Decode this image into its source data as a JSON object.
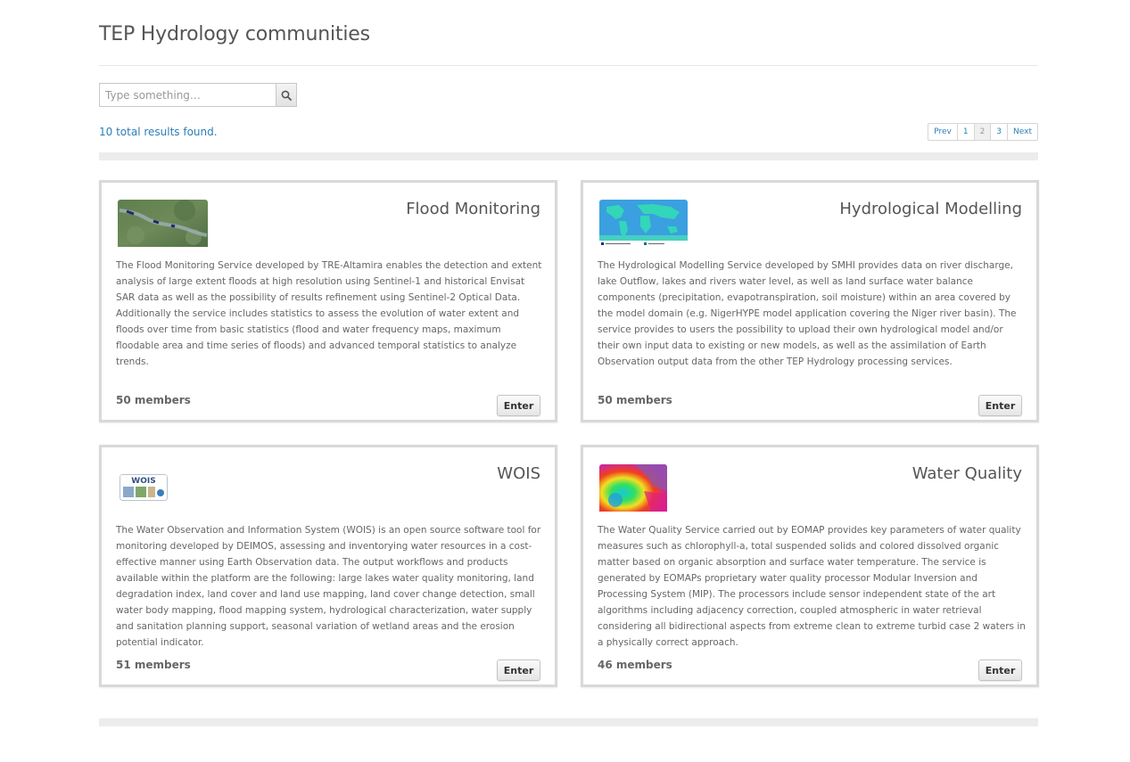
{
  "page_title": "TEP Hydrology communities",
  "search": {
    "placeholder": "Type something…",
    "icon": "search-icon"
  },
  "results_text": "10 total results found.",
  "pagination": {
    "prev": "Prev",
    "pages": [
      "1",
      "2",
      "3"
    ],
    "current": "2",
    "next": "Next"
  },
  "cards": [
    {
      "title": "Flood Monitoring",
      "description": "The Flood Monitoring Service developed by TRE-Altamira enables the detection and extent analysis of large extent floods at high resolution using Sentinel-1 and historical Envisat SAR data as well as the possibility of results refinement using Sentinel-2 Optical Data. Additionally the service includes statistics to assess the evolution of water extent and floods over time from basic statistics (flood and water frequency maps, maximum floodable area and time series of floods) and advanced temporal statistics to analyze trends.",
      "members": "50 members",
      "enter": "Enter",
      "thumb": "satellite-flood-image"
    },
    {
      "title": "Hydrological Modelling",
      "description": "The Hydrological Modelling Service developed by SMHI provides data on river discharge, lake Outflow, lakes and rivers water level, as well as land surface water balance components (precipitation, evapotranspiration, soil moisture) within an area covered by the model domain (e.g. NigerHYPE model application covering the Niger river basin). The service provides to users the possibility to upload their own hydrological model and/or their own input data to existing or new models, as well as the assimilation of Earth Observation output data from the other TEP Hydrology processing services.",
      "members": "50 members",
      "enter": "Enter",
      "thumb": "world-map-image"
    },
    {
      "title": "WOIS",
      "description": "The Water Observation and Information System (WOIS) is an open source software tool for monitoring developed by DEIMOS, assessing and inventorying water resources in a cost-effective manner using Earth Observation data. The output workflows and products available within the platform are the following: large lakes water quality monitoring, land degradation index, land cover and land use mapping, land cover change detection, small water body mapping, flood mapping system, hydrological characterization, water supply and sanitation planning support, seasonal variation of wetland areas and the erosion potential indicator.",
      "members": "51 members",
      "enter": "Enter",
      "thumb": "wois-logo",
      "thumb_text": "WOIS"
    },
    {
      "title": "Water Quality",
      "description": "The Water Quality Service carried out by EOMAP provides key parameters of water quality measures such as chlorophyll-a, total suspended solids and colored dissolved organic matter based on organic absorption and surface water temperature. The service is generated by EOMAPs proprietary water quality processor Modular Inversion and Processing System (MIP). The processors include sensor independent state of the art algorithms including adjacency correction, coupled atmospheric in water retrieval considering all bidirectional aspects from extreme clean to extreme turbid case 2 waters in a physically correct approach.",
      "members": "46 members",
      "enter": "Enter",
      "thumb": "water-quality-map-image"
    }
  ]
}
